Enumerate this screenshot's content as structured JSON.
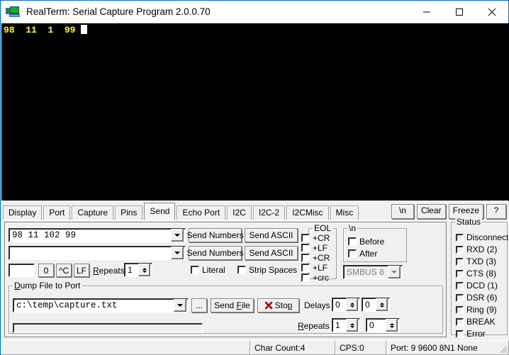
{
  "window": {
    "title": "RealTerm: Serial Capture Program 2.0.0.70",
    "icon": "computer-monitor-icon",
    "minimize": "—",
    "maximize": "□",
    "close": "✕",
    "accent_color": "#0a6cbc"
  },
  "terminal": {
    "text": "98  11  1  99 ",
    "fg_color": "#ffff00",
    "bg_color": "#000000",
    "cursor": "block-cursor"
  },
  "tabs": [
    {
      "label": "Display",
      "active": false
    },
    {
      "label": "Port",
      "active": false
    },
    {
      "label": "Capture",
      "active": false
    },
    {
      "label": "Pins",
      "active": false
    },
    {
      "label": "Send",
      "active": true
    },
    {
      "label": "Echo Port",
      "active": false
    },
    {
      "label": "I2C",
      "active": false
    },
    {
      "label": "I2C-2",
      "active": false
    },
    {
      "label": "I2CMisc",
      "active": false
    },
    {
      "label": "Misc",
      "active": false
    }
  ],
  "tab_buttons": {
    "newline": "\\n",
    "clear": "Clear",
    "freeze": "Freeze",
    "help": "?"
  },
  "send": {
    "line1_value": "98 11 102 99",
    "line2_value": "",
    "send_numbers_1": "Send Numbers",
    "send_ascii_1": "Send ASCII",
    "send_numbers_2": "Send Numbers",
    "send_ascii_2": "Send ASCII",
    "small_value": "",
    "btn_zero": "0",
    "btn_ctrlc": "^C",
    "btn_lf": "LF",
    "repeats_label": "Repeats",
    "repeats_value": "1",
    "literal_label": "Literal",
    "literal_checked": false,
    "strip_spaces_label": "Strip Spaces",
    "strip_spaces_checked": false
  },
  "eol": {
    "caption": "EOL",
    "items": [
      {
        "label": "+CR",
        "checked": false
      },
      {
        "label": "+LF",
        "checked": false
      },
      {
        "label": "+CR",
        "checked": false
      },
      {
        "label": "+LF",
        "checked": false
      },
      {
        "label": "+crc",
        "checked": false
      }
    ]
  },
  "newline_group": {
    "caption": "\\n",
    "before_label": "Before",
    "before_checked": false,
    "after_label": "After",
    "after_checked": false,
    "crc_mode": "SMBUS 8",
    "crc_disabled": true
  },
  "dump": {
    "caption": "Dump File to Port",
    "file_path": "c:\\temp\\capture.txt",
    "browse_label": "...",
    "send_file_label": "Send File",
    "stop_label": "Stop",
    "stop_icon": "red-x-icon",
    "delays_label": "Delays",
    "delay1_value": "0",
    "delay2_value": "0",
    "repeats_label": "Repeats",
    "repeats_value": "1",
    "repeats2_value": "0",
    "progress_dashes": "-----------",
    "progress_percent": 0
  },
  "status_group": {
    "caption": "Status",
    "items": [
      {
        "label": "Disconnect",
        "on": false
      },
      {
        "label": "RXD (2)",
        "on": false
      },
      {
        "label": "TXD (3)",
        "on": false
      },
      {
        "label": "CTS (8)",
        "on": false
      },
      {
        "label": "DCD (1)",
        "on": false
      },
      {
        "label": "DSR (6)",
        "on": false
      },
      {
        "label": "Ring (9)",
        "on": false
      },
      {
        "label": "BREAK",
        "on": false
      },
      {
        "label": "Error",
        "on": false
      }
    ]
  },
  "statusbar": {
    "cell0": "",
    "char_count": "Char Count:4",
    "cps": "CPS:0",
    "port": "Port: 9 9600 8N1 None"
  }
}
